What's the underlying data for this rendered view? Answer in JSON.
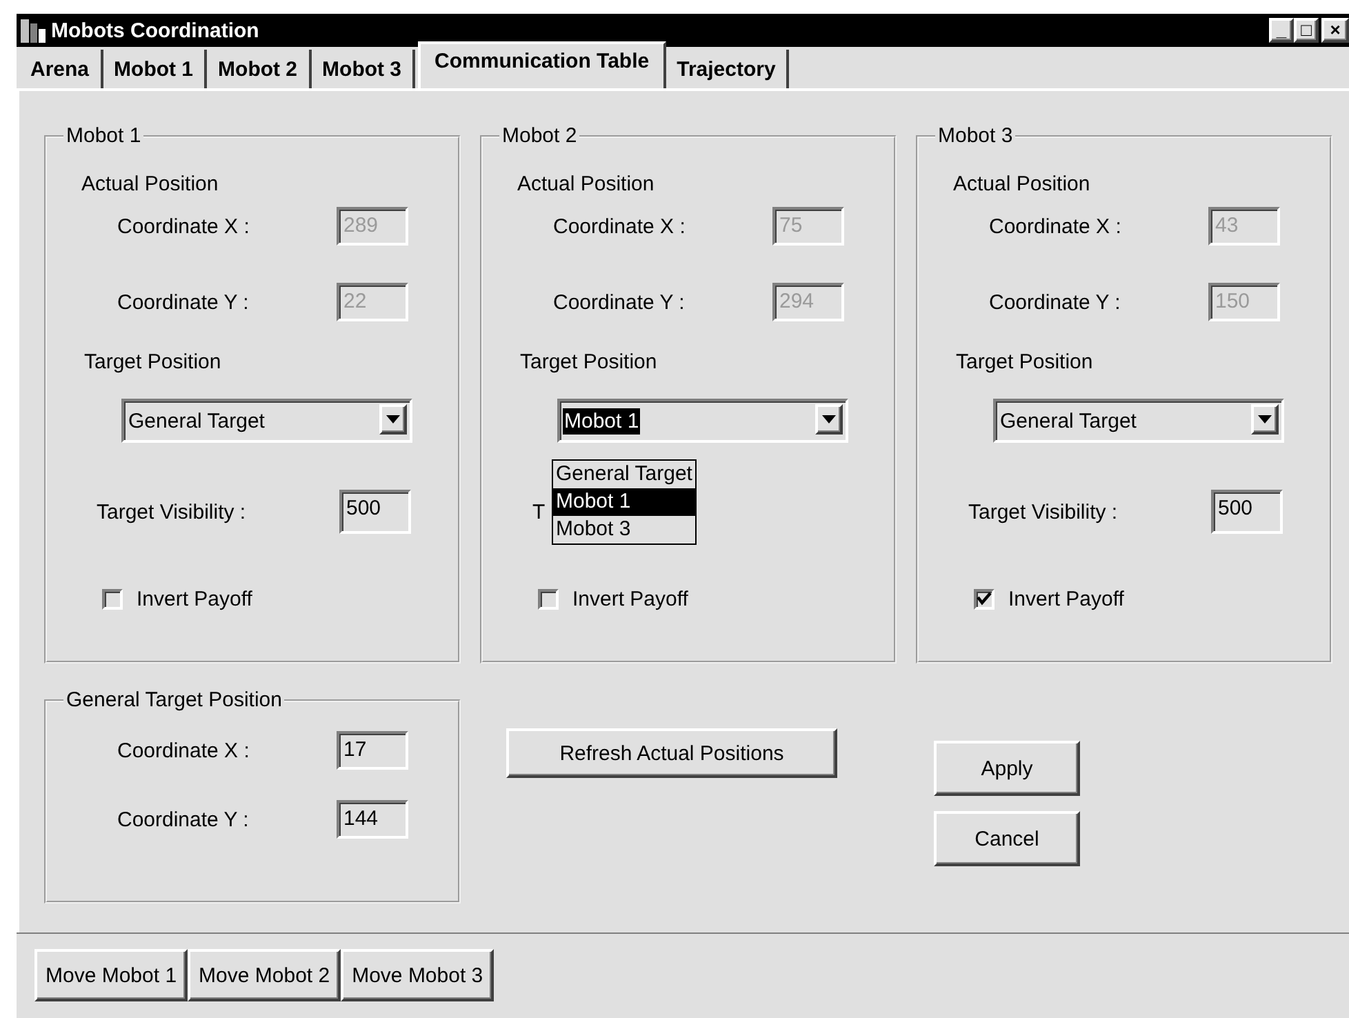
{
  "window": {
    "title": "Mobots Coordination",
    "controls": [
      "_",
      "□",
      "×"
    ]
  },
  "tabs": [
    {
      "label": "Arena",
      "selected": false
    },
    {
      "label": "Mobot 1",
      "selected": false
    },
    {
      "label": "Mobot 2",
      "selected": false
    },
    {
      "label": "Mobot 3",
      "selected": false
    },
    {
      "label": "Communication Table",
      "selected": true
    },
    {
      "label": "Trajectory",
      "selected": false
    }
  ],
  "panels": [
    {
      "title": "Mobot 1",
      "actual_label": "Actual Position",
      "x_label": "Coordinate X :",
      "x_value": "289",
      "y_label": "Coordinate Y :",
      "y_value": "22",
      "actual_disabled": true,
      "target_label": "Target Position",
      "target": {
        "value": "General Target",
        "open": false
      },
      "visibility": {
        "label": "Target Visibility :",
        "value": "500"
      },
      "invert": {
        "label": "Invert Payoff",
        "checked": false
      }
    },
    {
      "title": "Mobot 2",
      "actual_label": "Actual Position",
      "x_label": "Coordinate X :",
      "x_value": "75",
      "y_label": "Coordinate Y :",
      "y_value": "294",
      "actual_disabled": true,
      "target_label": "Target Position",
      "target": {
        "value": "Mobot 1",
        "open": true,
        "options": [
          {
            "label": "General Target",
            "selected": false
          },
          {
            "label": "Mobot 1",
            "selected": true
          },
          {
            "label": "Mobot 3",
            "selected": false
          }
        ]
      },
      "visibility": {
        "label": "T"
      },
      "invert": {
        "label": "Invert Payoff",
        "checked": false
      }
    },
    {
      "title": "Mobot 3",
      "actual_label": "Actual Position",
      "x_label": "Coordinate X :",
      "x_value": "43",
      "y_label": "Coordinate Y :",
      "y_value": "150",
      "actual_disabled": true,
      "target_label": "Target Position",
      "target": {
        "value": "General Target",
        "open": false
      },
      "visibility": {
        "label": "Target Visibility :",
        "value": "500"
      },
      "invert": {
        "label": "Invert Payoff",
        "checked": true
      }
    }
  ],
  "general_target": {
    "title": "General Target Position",
    "x_label": "Coordinate X :",
    "x_value": "17",
    "y_label": "Coordinate Y :",
    "y_value": "144"
  },
  "refresh_button": "Refresh Actual Positions",
  "buttons": [
    "Apply",
    "Cancel"
  ],
  "toolbar": [
    "Move Mobot 1",
    "Move Mobot 2",
    "Move Mobot 3"
  ]
}
